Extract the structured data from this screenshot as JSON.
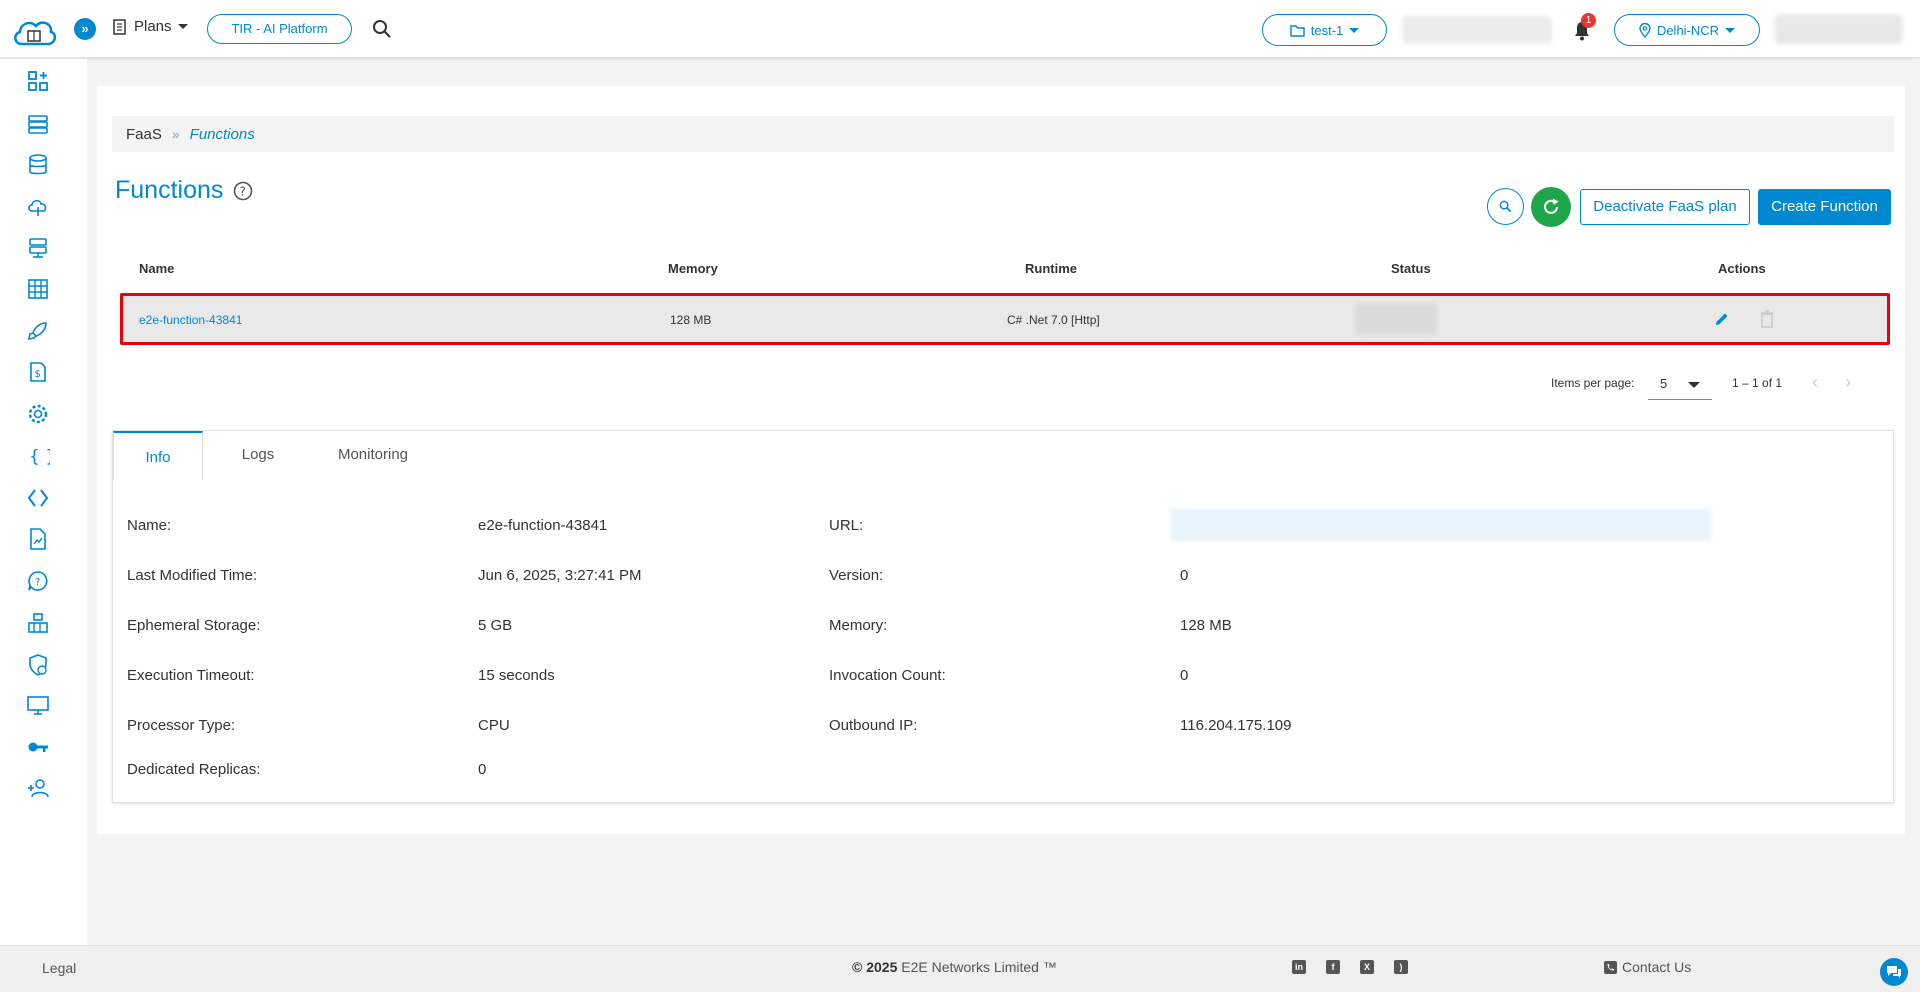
{
  "header": {
    "plans_label": "Plans",
    "tir_label": "TIR - AI Platform",
    "project_label": "test-1",
    "notification_count": "1",
    "region_label": "Delhi-NCR"
  },
  "breadcrumb": {
    "first": "FaaS",
    "separator": "»",
    "current": "Functions"
  },
  "page": {
    "title": "Functions",
    "deactivate_label": "Deactivate FaaS plan",
    "create_label": "Create Function"
  },
  "table": {
    "headers": {
      "name": "Name",
      "memory": "Memory",
      "runtime": "Runtime",
      "status": "Status",
      "actions": "Actions"
    },
    "rows": [
      {
        "name": "e2e-function-43841",
        "memory": "128 MB",
        "runtime": "C# .Net 7.0 [Http]"
      }
    ]
  },
  "pagination": {
    "items_per_page_label": "Items per page:",
    "items_per_page_value": "5",
    "range": "1 – 1 of 1"
  },
  "details": {
    "tabs": [
      "Info",
      "Logs",
      "Monitoring"
    ],
    "left": [
      {
        "label": "Name:",
        "value": "e2e-function-43841"
      },
      {
        "label": "Last Modified Time:",
        "value": "Jun 6, 2025, 3:27:41 PM"
      },
      {
        "label": "Ephemeral Storage:",
        "value": "5 GB"
      },
      {
        "label": "Execution Timeout:",
        "value": "15 seconds"
      },
      {
        "label": "Processor Type:",
        "value": "CPU"
      },
      {
        "label": "Dedicated Replicas:",
        "value": "0"
      }
    ],
    "right": [
      {
        "label": "URL:",
        "value": ""
      },
      {
        "label": "Version:",
        "value": "0"
      },
      {
        "label": "Memory:",
        "value": "128 MB"
      },
      {
        "label": "Invocation Count:",
        "value": "0"
      },
      {
        "label": "Outbound IP:",
        "value": "116.204.175.109"
      }
    ]
  },
  "footer": {
    "legal": "Legal",
    "copyright_prefix": "© 2025",
    "copyright_rest": "E2E Networks Limited ™",
    "contact": "Contact Us"
  },
  "colors": {
    "accent": "#0088d1",
    "refresh": "#1fa54a",
    "highlight": "#e8000b"
  }
}
